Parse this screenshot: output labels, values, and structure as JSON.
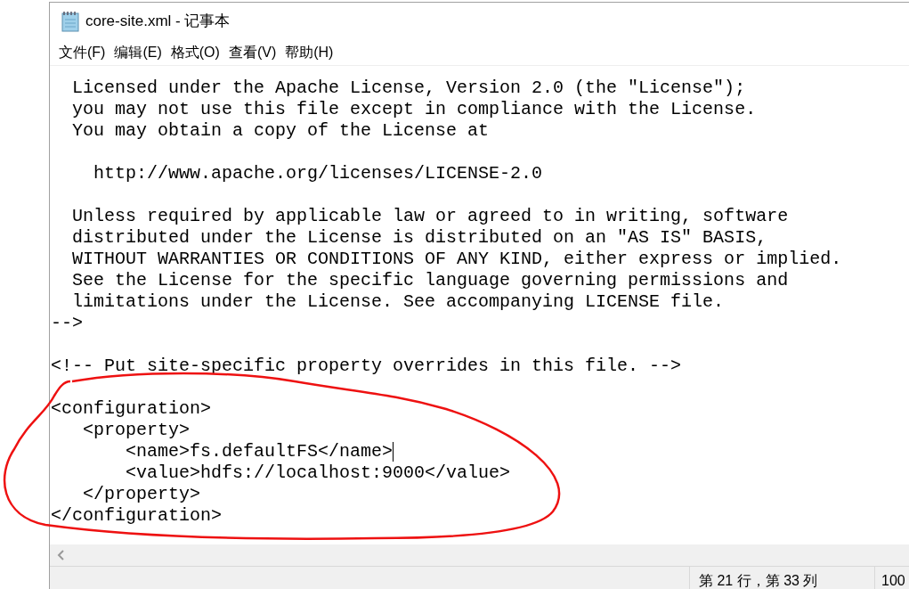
{
  "window": {
    "title": "core-site.xml - 记事本"
  },
  "menu": [
    "文件(F)",
    "编辑(E)",
    "格式(O)",
    "查看(V)",
    "帮助(H)"
  ],
  "editor": {
    "blocks": [
      [
        "  Licensed under the Apache License, Version 2.0 (the \"License\");",
        "  you may not use this file except in compliance with the License.",
        "  You may obtain a copy of the License at"
      ],
      [
        "    http://www.apache.org/licenses/LICENSE-2.0"
      ],
      [
        "  Unless required by applicable law or agreed to in writing, software",
        "  distributed under the License is distributed on an \"AS IS\" BASIS,",
        "  WITHOUT WARRANTIES OR CONDITIONS OF ANY KIND, either express or implied.",
        "  See the License for the specific language governing permissions and",
        "  limitations under the License. See accompanying LICENSE file.",
        "-->"
      ],
      [
        "<!-- Put site-specific property overrides in this file. -->"
      ],
      [
        "<configuration>",
        "   <property>",
        "       <name>fs.defaultFS</name>",
        "       <value>hdfs://localhost:9000</value>",
        "   </property>",
        "</configuration>"
      ]
    ]
  },
  "status_bar": {
    "position": "第 21 行，第 33 列",
    "zoom": "100"
  }
}
